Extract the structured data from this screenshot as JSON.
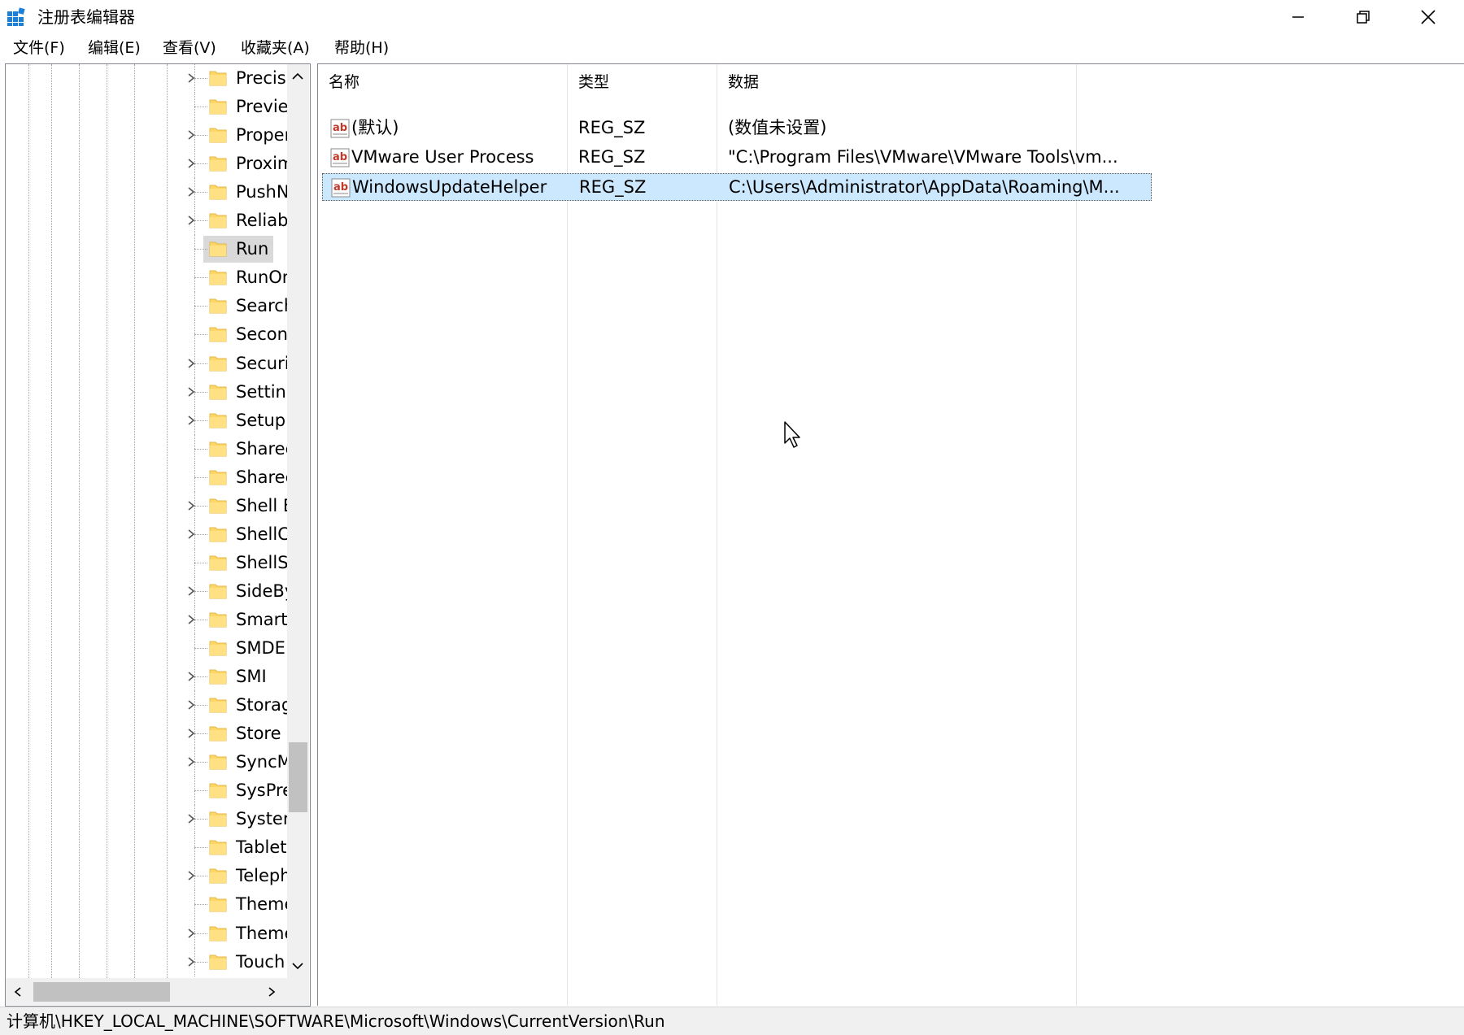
{
  "window": {
    "title": "注册表编辑器",
    "icon": "regedit-icon",
    "controls": [
      "minimize-icon",
      "restore-icon",
      "close-icon"
    ]
  },
  "menu": [
    "文件(F)",
    "编辑(E)",
    "查看(V)",
    "收藏夹(A)",
    "帮助(H)"
  ],
  "tree": {
    "items": [
      {
        "label": "Precisi",
        "expandable": true
      },
      {
        "label": "Previev",
        "expandable": false
      },
      {
        "label": "Proper",
        "expandable": true
      },
      {
        "label": "Proxim",
        "expandable": true
      },
      {
        "label": "PushN",
        "expandable": true
      },
      {
        "label": "Reliabi",
        "expandable": true
      },
      {
        "label": "Run",
        "expandable": false,
        "selected": true
      },
      {
        "label": "RunOn",
        "expandable": false
      },
      {
        "label": "Search",
        "expandable": false
      },
      {
        "label": "Secon",
        "expandable": false
      },
      {
        "label": "Securit",
        "expandable": true
      },
      {
        "label": "Setting",
        "expandable": true
      },
      {
        "label": "Setup",
        "expandable": true
      },
      {
        "label": "Sharec",
        "expandable": false
      },
      {
        "label": "Sharec",
        "expandable": false
      },
      {
        "label": "Shell E",
        "expandable": true
      },
      {
        "label": "ShellC",
        "expandable": true
      },
      {
        "label": "ShellSe",
        "expandable": false
      },
      {
        "label": "SideBy",
        "expandable": true
      },
      {
        "label": "Smart(",
        "expandable": true
      },
      {
        "label": "SMDE",
        "expandable": false
      },
      {
        "label": "SMI",
        "expandable": true
      },
      {
        "label": "Storag",
        "expandable": true
      },
      {
        "label": "Store",
        "expandable": true
      },
      {
        "label": "SyncM",
        "expandable": true
      },
      {
        "label": "SysPre",
        "expandable": false
      },
      {
        "label": "Syster",
        "expandable": true
      },
      {
        "label": "Tablet",
        "expandable": false
      },
      {
        "label": "Teleph",
        "expandable": true
      },
      {
        "label": "Theme",
        "expandable": false
      },
      {
        "label": "Theme",
        "expandable": true
      },
      {
        "label": "Touch",
        "expandable": true
      }
    ],
    "vscroll_position": 0.78,
    "hscroll_position": 0.1
  },
  "list": {
    "columns": [
      "名称",
      "类型",
      "数据"
    ],
    "rows": [
      {
        "icon": "ab-string-icon",
        "name": "(默认)",
        "type": "REG_SZ",
        "data": "(数值未设置)"
      },
      {
        "icon": "ab-string-icon",
        "name": "VMware User Process",
        "type": "REG_SZ",
        "data": "\"C:\\Program Files\\VMware\\VMware Tools\\vm..."
      },
      {
        "icon": "ab-string-icon",
        "name": "WindowsUpdateHelper",
        "type": "REG_SZ",
        "data": "C:\\Users\\Administrator\\AppData\\Roaming\\M...",
        "selected": true
      }
    ]
  },
  "status": {
    "path": "计算机\\HKEY_LOCAL_MACHINE\\SOFTWARE\\Microsoft\\Windows\\CurrentVersion\\Run"
  },
  "colors": {
    "selection": "#cce8ff",
    "tree_selection": "#d9d9d9",
    "folder": "#ffd766"
  }
}
